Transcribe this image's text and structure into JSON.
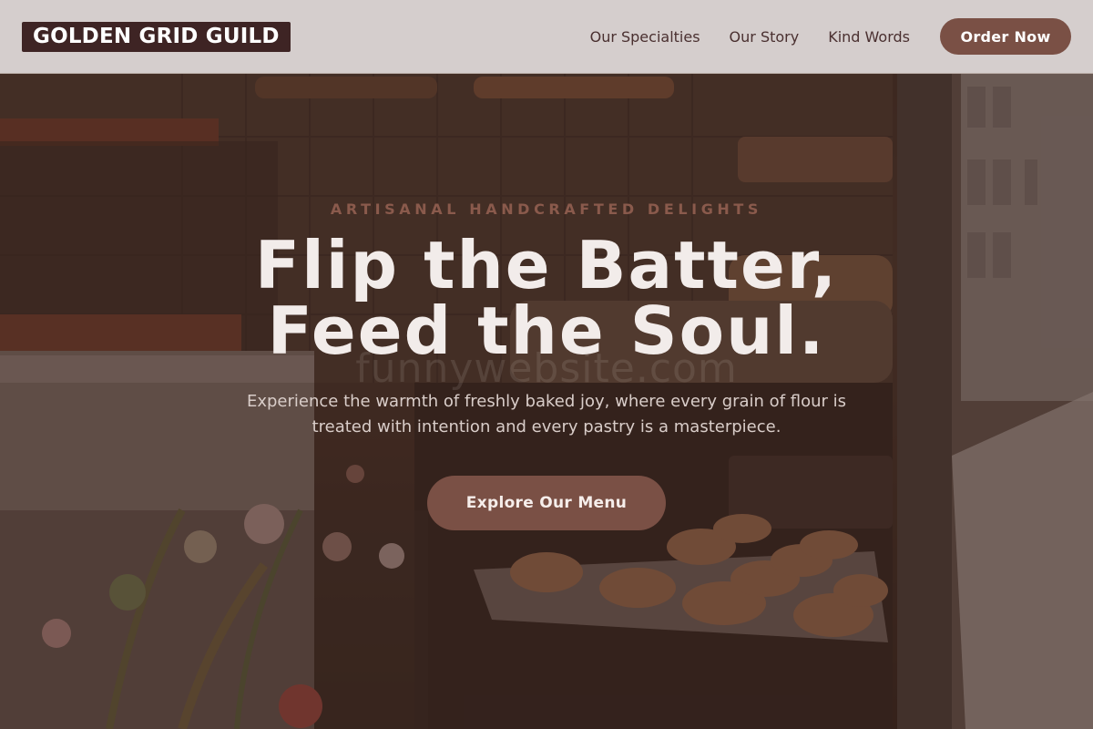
{
  "brand": {
    "logo_text": "GOLDEN GRID GUILD"
  },
  "nav": {
    "links": [
      {
        "label": "Our Specialties"
      },
      {
        "label": "Our Story"
      },
      {
        "label": "Kind Words"
      }
    ],
    "order_button": "Order Now"
  },
  "hero": {
    "eyebrow": "ARTISANAL HANDCRAFTED DELIGHTS",
    "headline_line1": "Flip the Batter,",
    "headline_line2": "Feed the Soul.",
    "watermark": "funnywebsite.com",
    "subtitle": "Experience the warmth of freshly baked joy, where every grain of flour is treated with intention and every pastry is a masterpiece.",
    "cta_label": "Explore Our Menu",
    "background_image": "bakery-display-photo"
  },
  "colors": {
    "nav_background": "#e1dcda",
    "logo_background": "#3e2424",
    "button_primary": "#7a5045",
    "eyebrow_text": "#8a5a4c",
    "headline_text": "#f2ecea",
    "hero_overlay": "#3c241e"
  }
}
